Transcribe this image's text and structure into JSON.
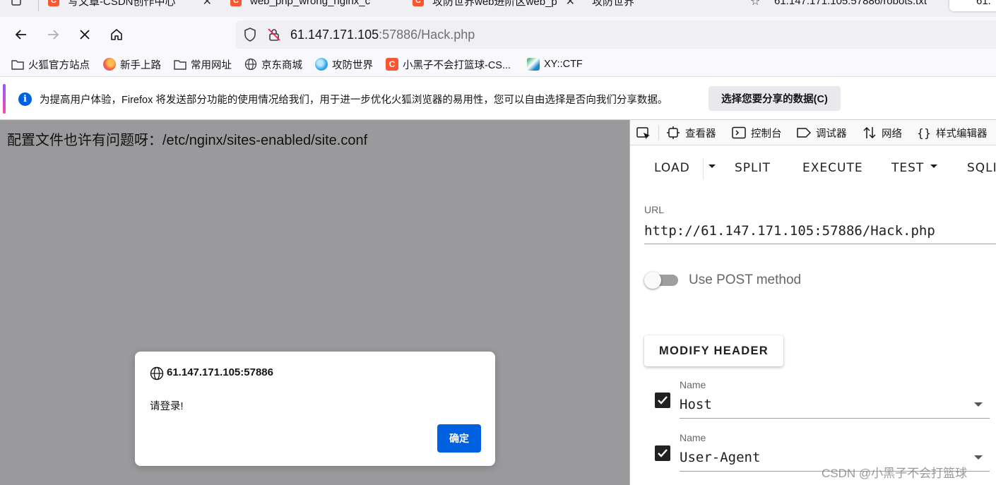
{
  "browser": {
    "tabs": [
      {
        "label": "写文章-CSDN创作中心",
        "close": "✕"
      },
      {
        "label": "web_php_wrong_nginx_c",
        "close": ""
      },
      {
        "label": "攻防世界web进阶区web_p",
        "close": "✕"
      },
      {
        "label": "攻防世界",
        "close": ""
      },
      {
        "label": "61.147.171.105:57886/robots.txt",
        "close": "✕"
      },
      {
        "label": "61.",
        "close": ""
      }
    ],
    "url_host": "61.147.171.105",
    "url_rest": ":57886/Hack.php",
    "bookmarks": [
      {
        "label": "火狐官方站点",
        "icon": "folder-icon"
      },
      {
        "label": "新手上路",
        "icon": "firefox-icon"
      },
      {
        "label": "常用网址",
        "icon": "folder-icon"
      },
      {
        "label": "京东商城",
        "icon": "globe-icon"
      },
      {
        "label": "攻防世界",
        "icon": "xctf-icon"
      },
      {
        "label": "小黑子不会打篮球-CS...",
        "icon": "csdn-icon"
      },
      {
        "label": "XY::CTF",
        "icon": "xyctf-icon"
      }
    ],
    "notification": {
      "text": "为提高用户体验，Firefox 将发送部分功能的使用情况给我们，用于进一步优化火狐浏览器的易用性，您可以自由选择是否向我们分享数据。",
      "button": "选择您要分享的数据(C)"
    }
  },
  "page": {
    "message": "配置文件也许有问题呀：/etc/nginx/sites-enabled/site.conf"
  },
  "dialog": {
    "origin": "61.147.171.105:57886",
    "message": "请登录!",
    "ok": "确定"
  },
  "devtools": {
    "tabs": [
      "查看器",
      "控制台",
      "调试器",
      "网络",
      "样式编辑器"
    ],
    "hackbar": {
      "menu": [
        "LOAD",
        "SPLIT",
        "EXECUTE",
        "TEST",
        "SQLI"
      ],
      "url_label": "URL",
      "url_value": "http://61.147.171.105:57886/Hack.php",
      "post_label": "Use POST method",
      "post_enabled": false,
      "modify_header": "MODIFY HEADER",
      "headers": [
        {
          "label": "Name",
          "value": "Host",
          "checked": true
        },
        {
          "label": "Name",
          "value": "User-Agent",
          "checked": true
        }
      ]
    }
  },
  "watermark": "CSDN @小黑子不会打篮球",
  "colors": {
    "accent": "#0061e0",
    "csdn": "#fc5531"
  }
}
